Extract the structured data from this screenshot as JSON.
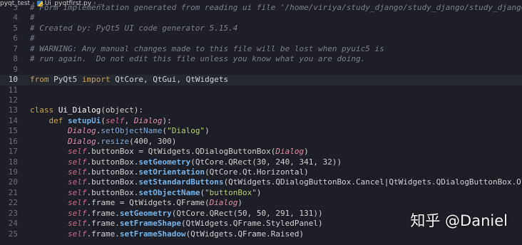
{
  "breadcrumb": {
    "folder": "pyqt_test",
    "file": "Ui_pyqtfirst.py",
    "rest": "..."
  },
  "editor": {
    "current_line": 10,
    "lines": [
      {
        "n": "3",
        "parts": [
          {
            "c": "cm",
            "t": "# Form implementation generated from reading ui file '/home/viriya/study_django/study_django/study_django/pyq"
          }
        ]
      },
      {
        "n": "4",
        "parts": [
          {
            "c": "cm",
            "t": "#"
          }
        ]
      },
      {
        "n": "5",
        "parts": [
          {
            "c": "cm",
            "t": "# Created by: PyQt5 UI code generator 5.15.4"
          }
        ]
      },
      {
        "n": "6",
        "parts": [
          {
            "c": "cm",
            "t": "#"
          }
        ]
      },
      {
        "n": "7",
        "parts": [
          {
            "c": "cm",
            "t": "# WARNING: Any manual changes made to this file will be lost when pyuic5 is"
          }
        ]
      },
      {
        "n": "8",
        "parts": [
          {
            "c": "cm",
            "t": "# run again.  Do not edit this file unless you know what you are doing."
          }
        ]
      },
      {
        "n": "9",
        "parts": []
      },
      {
        "n": "10",
        "parts": [
          {
            "c": "kw",
            "t": "from "
          },
          {
            "c": "txt",
            "t": "PyQt5 "
          },
          {
            "c": "kw",
            "t": "import "
          },
          {
            "c": "txt",
            "t": "QtCore, QtGui, QtWidgets"
          }
        ]
      },
      {
        "n": "11",
        "parts": []
      },
      {
        "n": "12",
        "parts": []
      },
      {
        "n": "13",
        "parts": [
          {
            "c": "kw",
            "t": "class "
          },
          {
            "c": "cls",
            "t": "Ui_Dialog"
          },
          {
            "c": "txt",
            "t": "(object):"
          }
        ]
      },
      {
        "n": "14",
        "parts": [
          {
            "c": "txt",
            "t": "    "
          },
          {
            "c": "kw",
            "t": "def "
          },
          {
            "c": "fn",
            "t": "setupUi"
          },
          {
            "c": "txt",
            "t": "("
          },
          {
            "c": "self",
            "t": "self"
          },
          {
            "c": "txt",
            "t": ", "
          },
          {
            "c": "param",
            "t": "Dialog"
          },
          {
            "c": "txt",
            "t": "):"
          }
        ]
      },
      {
        "n": "15",
        "parts": [
          {
            "c": "txt",
            "t": "        "
          },
          {
            "c": "param",
            "t": "Dialog"
          },
          {
            "c": "txt",
            "t": "."
          },
          {
            "c": "call",
            "t": "setObjectName"
          },
          {
            "c": "txt",
            "t": "("
          },
          {
            "c": "str",
            "t": "\"Dialog\""
          },
          {
            "c": "txt",
            "t": ")"
          }
        ]
      },
      {
        "n": "16",
        "parts": [
          {
            "c": "txt",
            "t": "        "
          },
          {
            "c": "param",
            "t": "Dialog"
          },
          {
            "c": "txt",
            "t": "."
          },
          {
            "c": "call",
            "t": "resize"
          },
          {
            "c": "txt",
            "t": "(400, 300)"
          }
        ]
      },
      {
        "n": "17",
        "parts": [
          {
            "c": "txt",
            "t": "        "
          },
          {
            "c": "self",
            "t": "self"
          },
          {
            "c": "txt",
            "t": ".buttonBox = QtWidgets.QDialogButtonBox("
          },
          {
            "c": "param",
            "t": "Dialog"
          },
          {
            "c": "txt",
            "t": ")"
          }
        ]
      },
      {
        "n": "18",
        "parts": [
          {
            "c": "txt",
            "t": "        "
          },
          {
            "c": "self",
            "t": "self"
          },
          {
            "c": "txt",
            "t": ".buttonBox."
          },
          {
            "c": "meth",
            "t": "setGeometry"
          },
          {
            "c": "txt",
            "t": "(QtCore.QRect(30, 240, 341, 32))"
          }
        ]
      },
      {
        "n": "19",
        "parts": [
          {
            "c": "txt",
            "t": "        "
          },
          {
            "c": "self",
            "t": "self"
          },
          {
            "c": "txt",
            "t": ".buttonBox."
          },
          {
            "c": "meth",
            "t": "setOrientation"
          },
          {
            "c": "txt",
            "t": "(QtCore.Qt.Horizontal)"
          }
        ]
      },
      {
        "n": "20",
        "parts": [
          {
            "c": "txt",
            "t": "        "
          },
          {
            "c": "self",
            "t": "self"
          },
          {
            "c": "txt",
            "t": ".buttonBox."
          },
          {
            "c": "meth",
            "t": "setStandardButtons"
          },
          {
            "c": "txt",
            "t": "(QtWidgets.QDialogButtonBox.Cancel|QtWidgets.QDialogButtonBox.Ok)"
          }
        ]
      },
      {
        "n": "21",
        "parts": [
          {
            "c": "txt",
            "t": "        "
          },
          {
            "c": "self",
            "t": "self"
          },
          {
            "c": "txt",
            "t": ".buttonBox."
          },
          {
            "c": "meth",
            "t": "setObjectName"
          },
          {
            "c": "txt",
            "t": "("
          },
          {
            "c": "str",
            "t": "\"buttonBox\""
          },
          {
            "c": "txt",
            "t": ")"
          }
        ]
      },
      {
        "n": "22",
        "parts": [
          {
            "c": "txt",
            "t": "        "
          },
          {
            "c": "self",
            "t": "self"
          },
          {
            "c": "txt",
            "t": ".frame = QtWidgets.QFrame("
          },
          {
            "c": "param",
            "t": "Dialog"
          },
          {
            "c": "txt",
            "t": ")"
          }
        ]
      },
      {
        "n": "23",
        "parts": [
          {
            "c": "txt",
            "t": "        "
          },
          {
            "c": "self",
            "t": "self"
          },
          {
            "c": "txt",
            "t": ".frame."
          },
          {
            "c": "meth",
            "t": "setGeometry"
          },
          {
            "c": "txt",
            "t": "(QtCore.QRect(50, 50, 291, 131))"
          }
        ]
      },
      {
        "n": "24",
        "parts": [
          {
            "c": "txt",
            "t": "        "
          },
          {
            "c": "self",
            "t": "self"
          },
          {
            "c": "txt",
            "t": ".frame."
          },
          {
            "c": "meth",
            "t": "setFrameShape"
          },
          {
            "c": "txt",
            "t": "(QtWidgets.QFrame.StyledPanel)"
          }
        ]
      },
      {
        "n": "25",
        "parts": [
          {
            "c": "txt",
            "t": "        "
          },
          {
            "c": "self",
            "t": "self"
          },
          {
            "c": "txt",
            "t": ".frame."
          },
          {
            "c": "meth",
            "t": "setFrameShadow"
          },
          {
            "c": "txt",
            "t": "(QtWidgets.QFrame.Raised)"
          }
        ]
      }
    ]
  },
  "watermark": "知乎 @Daniel",
  "colors": {
    "background": "#1e1f26",
    "comment": "#7b7f8c",
    "keyword": "#c6a25a",
    "method": "#77b2e6",
    "self": "#c96c8a",
    "string": "#b5cc78"
  }
}
